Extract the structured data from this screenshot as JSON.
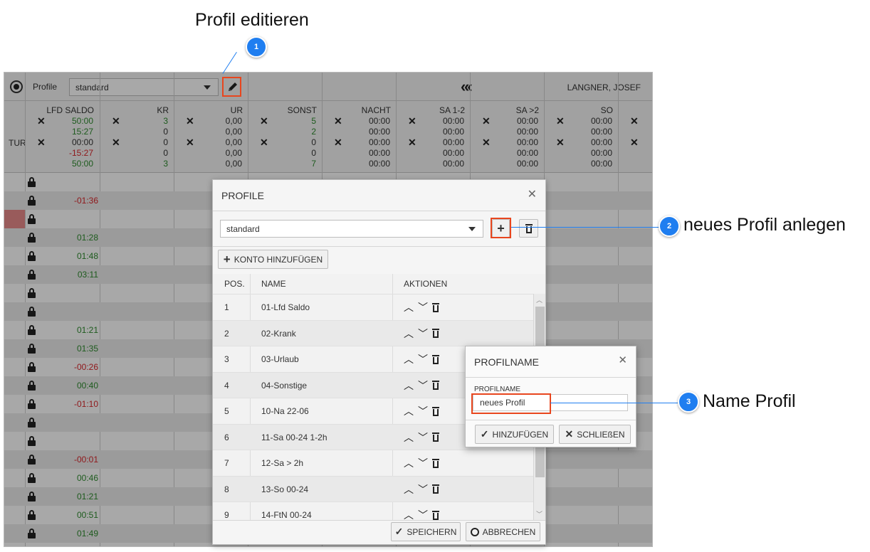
{
  "annotations": {
    "edit_title": "Profil editieren",
    "new_profile_title": "neues Profil anlegen",
    "name_title": "Name Profil",
    "badge1": "1",
    "badge2": "2",
    "badge3": "3"
  },
  "topbar": {
    "profile_label": "Profile",
    "profile_value": "standard",
    "nav_icon": "double-chevron-left-icon",
    "nav_glyph": "«‹",
    "user_name": "LANGNER, JOSEF"
  },
  "summary": {
    "left_label": "TUR",
    "columns": [
      {
        "header": "LFD SALDO",
        "values": [
          "50:00",
          "15:27",
          "00:00",
          "-15:27",
          "50:00"
        ],
        "colors": [
          "green",
          "green",
          "dark",
          "red",
          "green"
        ],
        "x_marks": [
          true,
          false,
          true,
          false,
          false
        ]
      },
      {
        "header": "KR",
        "values": [
          "3",
          "0",
          "0",
          "0",
          "3"
        ],
        "colors": [
          "green",
          "dark",
          "dark",
          "dark",
          "green"
        ],
        "x_marks": [
          true,
          false,
          true,
          false,
          false
        ]
      },
      {
        "header": "UR",
        "values": [
          "0,00",
          "0,00",
          "0,00",
          "0,00",
          "0,00"
        ],
        "colors": [
          "dark",
          "dark",
          "dark",
          "dark",
          "dark"
        ],
        "x_marks": [
          true,
          false,
          true,
          false,
          false
        ]
      },
      {
        "header": "SONST",
        "values": [
          "5",
          "2",
          "0",
          "0",
          "7"
        ],
        "colors": [
          "green",
          "green",
          "dark",
          "dark",
          "green"
        ],
        "x_marks": [
          true,
          false,
          true,
          false,
          false
        ]
      },
      {
        "header": "NACHT",
        "values": [
          "00:00",
          "00:00",
          "00:00",
          "00:00",
          "00:00"
        ],
        "colors": [
          "dark",
          "dark",
          "dark",
          "dark",
          "dark"
        ],
        "x_marks": [
          true,
          false,
          true,
          false,
          false
        ]
      },
      {
        "header": "SA 1-2",
        "values": [
          "00:00",
          "00:00",
          "00:00",
          "00:00",
          "00:00"
        ],
        "colors": [
          "dark",
          "dark",
          "dark",
          "dark",
          "dark"
        ],
        "x_marks": [
          true,
          false,
          true,
          false,
          false
        ]
      },
      {
        "header": "SA >2",
        "values": [
          "00:00",
          "00:00",
          "00:00",
          "00:00",
          "00:00"
        ],
        "colors": [
          "dark",
          "dark",
          "dark",
          "dark",
          "dark"
        ],
        "x_marks": [
          true,
          false,
          true,
          false,
          false
        ]
      },
      {
        "header": "SO",
        "values": [
          "00:00",
          "00:00",
          "00:00",
          "00:00",
          "00:00"
        ],
        "colors": [
          "dark",
          "dark",
          "dark",
          "dark",
          "dark"
        ],
        "x_marks": [
          true,
          false,
          true,
          false,
          false
        ]
      },
      {
        "header": "",
        "values": [],
        "colors": [],
        "x_marks": [
          true,
          false,
          true,
          false,
          false
        ]
      }
    ]
  },
  "day_rows": [
    {
      "value": "",
      "color": "dark"
    },
    {
      "value": "-01:36",
      "color": "red"
    },
    {
      "value": "",
      "color": "dark",
      "highlight": true
    },
    {
      "value": "01:28",
      "color": "green"
    },
    {
      "value": "01:48",
      "color": "green"
    },
    {
      "value": "03:11",
      "color": "green"
    },
    {
      "value": "",
      "color": "dark"
    },
    {
      "value": "",
      "color": "dark"
    },
    {
      "value": "01:21",
      "color": "green"
    },
    {
      "value": "01:35",
      "color": "green"
    },
    {
      "value": "-00:26",
      "color": "red"
    },
    {
      "value": "00:40",
      "color": "green"
    },
    {
      "value": "-01:10",
      "color": "red"
    },
    {
      "value": "",
      "color": "dark"
    },
    {
      "value": "",
      "color": "dark"
    },
    {
      "value": "-00:01",
      "color": "red"
    },
    {
      "value": "00:46",
      "color": "green"
    },
    {
      "value": "01:21",
      "color": "green"
    },
    {
      "value": "00:51",
      "color": "green"
    },
    {
      "value": "01:49",
      "color": "green"
    }
  ],
  "profile_modal": {
    "title": "PROFILE",
    "close": "✕",
    "profile_value": "standard",
    "add_button": "+",
    "add_account_label": "KONTO HINZUFÜGEN",
    "col_pos": "POS.",
    "col_name": "NAME",
    "col_actions": "AKTIONEN",
    "rows": [
      {
        "pos": "1",
        "name": "01-Lfd Saldo"
      },
      {
        "pos": "2",
        "name": "02-Krank"
      },
      {
        "pos": "3",
        "name": "03-Urlaub"
      },
      {
        "pos": "4",
        "name": "04-Sonstige"
      },
      {
        "pos": "5",
        "name": "10-Na 22-06"
      },
      {
        "pos": "6",
        "name": "11-Sa 00-24 1-2h"
      },
      {
        "pos": "7",
        "name": "12-Sa > 2h"
      },
      {
        "pos": "8",
        "name": "13-So 00-24"
      },
      {
        "pos": "9",
        "name": "14-FtN 00-24"
      }
    ],
    "save_label": "SPEICHERN",
    "cancel_label": "ABBRECHEN"
  },
  "name_modal": {
    "title": "PROFILNAME",
    "close": "✕",
    "field_label": "PROFILNAME",
    "field_value": "neues Profil",
    "add_label": "HINZUFÜGEN",
    "close_label": "SCHLIEßEN"
  },
  "colors": {
    "green": "#2e8b2e",
    "red": "#d9262b",
    "dark": "#333333",
    "accent": "#1f7ef0",
    "highlight_box": "#e8461e"
  }
}
